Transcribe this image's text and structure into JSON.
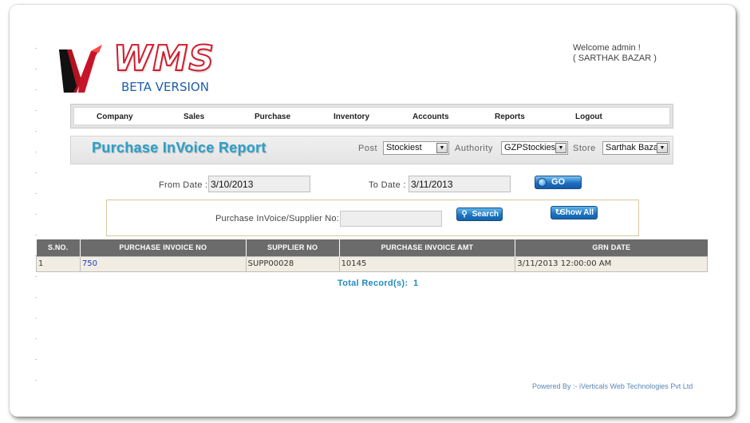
{
  "logo": {
    "text": "WMS",
    "subtitle": "BETA VERSION"
  },
  "welcome": {
    "line1": "Welcome admin !",
    "line2": "( SARTHAK BAZAR )"
  },
  "nav": {
    "items": [
      {
        "label": "Company"
      },
      {
        "label": "Sales"
      },
      {
        "label": "Purchase"
      },
      {
        "label": "Inventory"
      },
      {
        "label": "Accounts"
      },
      {
        "label": "Reports"
      },
      {
        "label": "Logout"
      }
    ]
  },
  "title": "Purchase InVoice Report",
  "filters": {
    "post_label": "Post",
    "post_value": "Stockiest",
    "authority_label": "Authority",
    "authority_value": "GZPStockies",
    "store_label": "Store",
    "store_value": "Sarthak Baza"
  },
  "dates": {
    "from_label": "From Date :",
    "from_value": "3/10/2013",
    "to_label": "To Date :",
    "to_value": "3/11/2013",
    "go_label": "GO"
  },
  "search": {
    "label": "Purchase InVoice/Supplier No:",
    "value": "",
    "search_label": "Search",
    "showall_label": "Show All"
  },
  "table": {
    "headers": [
      "S.NO.",
      "PURCHASE INVOICE NO",
      "SUPPLIER NO",
      "PURCHASE INVOICE AMT",
      "GRN DATE"
    ],
    "rows": [
      [
        "1",
        "750",
        "SUPP00028",
        "10145",
        "3/11/2013 12:00:00 AM"
      ]
    ]
  },
  "total": {
    "label": "Total Record(s):",
    "value": "1"
  },
  "footer": "Powered By :- iVerticals Web Technologies Pvt Ltd",
  "colors": {
    "accent": "#2aa0c9",
    "brand_red": "#d11b2c",
    "brand_blue": "#1e5fa8",
    "header_gray": "#6b6b6b"
  }
}
